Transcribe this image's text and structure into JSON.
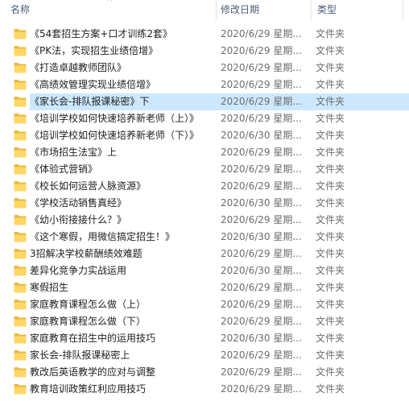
{
  "header": {
    "name_label": "名称",
    "date_label": "修改日期",
    "type_label": "类型",
    "sort_indicator": "^"
  },
  "colors": {
    "folder_body": "#ffd766",
    "folder_tab": "#e8b93c",
    "selection": "#cce8ff"
  },
  "selected_index": 4,
  "rows": [
    {
      "name": "《54套招生方案+口才训练2套》",
      "date": "2020/6/29 星期...",
      "type": "文件夹"
    },
    {
      "name": "《PK法，实现招生业绩倍增》",
      "date": "2020/6/29 星期...",
      "type": "文件夹"
    },
    {
      "name": "《打造卓越教师团队》",
      "date": "2020/6/29 星期...",
      "type": "文件夹"
    },
    {
      "name": "《高绩效管理实现业绩倍增》",
      "date": "2020/6/29 星期...",
      "type": "文件夹"
    },
    {
      "name": "《家长会-排队报课秘密》下",
      "date": "2020/6/29 星期...",
      "type": "文件夹"
    },
    {
      "name": "《培训学校如何快速培养新老师（上）》",
      "date": "2020/6/29 星期...",
      "type": "文件夹"
    },
    {
      "name": "《培训学校如何快速培养新老师（下）》",
      "date": "2020/6/30 星期...",
      "type": "文件夹"
    },
    {
      "name": "《市场招生法宝》上",
      "date": "2020/6/29 星期...",
      "type": "文件夹"
    },
    {
      "name": "《体验式营销》",
      "date": "2020/6/29 星期...",
      "type": "文件夹"
    },
    {
      "name": "《校长如何运营人脉资源》",
      "date": "2020/6/29 星期...",
      "type": "文件夹"
    },
    {
      "name": "《学校活动销售真经》",
      "date": "2020/6/30 星期...",
      "type": "文件夹"
    },
    {
      "name": "《幼小衔接接什么？》",
      "date": "2020/6/29 星期...",
      "type": "文件夹"
    },
    {
      "name": "《这个寒假，用微信搞定招生！》",
      "date": "2020/6/30 星期...",
      "type": "文件夹"
    },
    {
      "name": "3招解决学校薪酬绩效难题",
      "date": "2020/6/29 星期...",
      "type": "文件夹"
    },
    {
      "name": "差异化竞争力实战运用",
      "date": "2020/6/30 星期...",
      "type": "文件夹"
    },
    {
      "name": "寒假招生",
      "date": "2020/6/29 星期...",
      "type": "文件夹"
    },
    {
      "name": "家庭教育课程怎么做（上）",
      "date": "2020/6/29 星期...",
      "type": "文件夹"
    },
    {
      "name": "家庭教育课程怎么做（下）",
      "date": "2020/6/29 星期...",
      "type": "文件夹"
    },
    {
      "name": "家庭教育在招生中的运用技巧",
      "date": "2020/6/30 星期...",
      "type": "文件夹"
    },
    {
      "name": "家长会-排队报课秘密上",
      "date": "2020/6/29 星期...",
      "type": "文件夹"
    },
    {
      "name": "教改后英语教学的应对与调整",
      "date": "2020/6/29 星期...",
      "type": "文件夹"
    },
    {
      "name": "教育培训政策红利应用技巧",
      "date": "2020/6/29 星期...",
      "type": "文件夹"
    }
  ]
}
